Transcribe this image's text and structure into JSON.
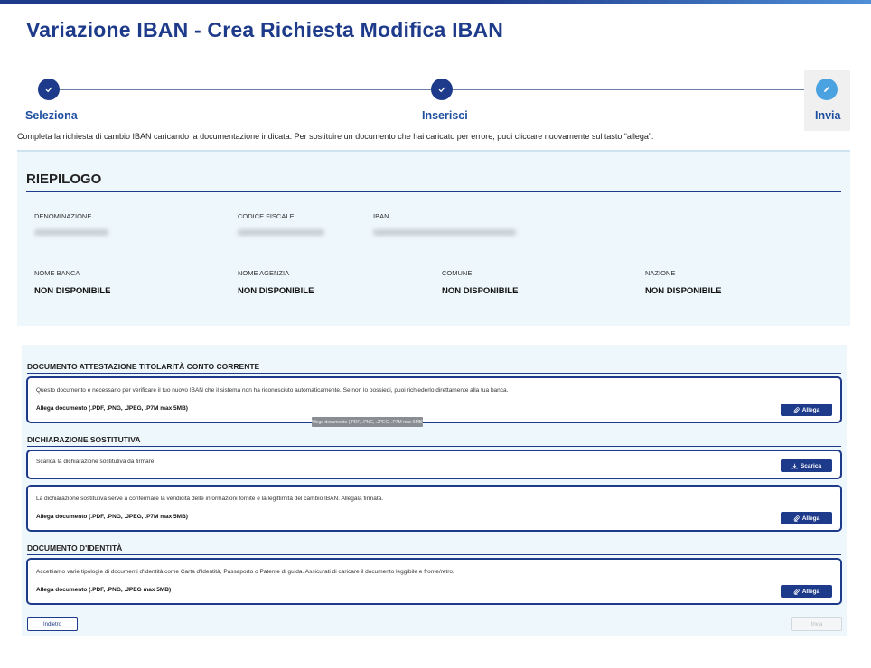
{
  "page": {
    "title": "Variazione IBAN - Crea Richiesta Modifica IBAN",
    "intro": "Completa la richiesta di cambio IBAN caricando la documentazione indicata. Per sostituire un documento che hai caricato per errore, puoi cliccare nuovamente sul tasto “allega”."
  },
  "stepper": {
    "steps": [
      {
        "label": "Seleziona",
        "state": "completed",
        "icon": "check-icon"
      },
      {
        "label": "Inserisci",
        "state": "completed",
        "icon": "check-icon"
      },
      {
        "label": "Invia",
        "state": "active",
        "icon": "pencil-icon"
      }
    ]
  },
  "summary": {
    "title": "RIEPILOGO",
    "fields": [
      {
        "label": "DENOMINAZIONE",
        "value": ""
      },
      {
        "label": "CODICE FISCALE",
        "value": ""
      },
      {
        "label": "IBAN",
        "value": ""
      },
      {
        "label": "NOME BANCA",
        "value": "NON DISPONIBILE"
      },
      {
        "label": "NOME AGENZIA",
        "value": "NON DISPONIBILE"
      },
      {
        "label": "COMUNE",
        "value": "NON DISPONIBILE"
      },
      {
        "label": "NAZIONE",
        "value": "NON DISPONIBILE"
      }
    ]
  },
  "documents": {
    "section1": {
      "title": "DOCUMENTO ATTESTAZIONE TITOLARITÀ CONTO CORRENTE",
      "desc": "Questo documento è necessario per verificare il tuo nuovo IBAN che il sistema non ha riconosciuto automaticamente. Se non lo possiedi, puoi richiederlo direttamente alla tua banca.",
      "allow": "Allega documento (.PDF, .PNG, .JPEG, .P7M max 5MB)",
      "button": "Allega"
    },
    "tooltip": "Allega documento (.PDF, .PNG, .JPEG, .P7M max 5MB)",
    "section2": {
      "title": "DICHIARAZIONE SOSTITUTIVA",
      "download_desc": "Scarica la dichiarazione sostitutiva da firmare",
      "download_button": "Scarica",
      "desc": "La dichiarazione sostitutiva serve a confermare la veridicità delle informazioni fornite e la legittimità del cambio IBAN. Allegala firmata.",
      "allow": "Allega documento (.PDF, .PNG, .JPEG, .P7M max 5MB)",
      "button": "Allega"
    },
    "section3": {
      "title": "DOCUMENTO D'IDENTITÀ",
      "desc": "Accettiamo varie tipologie di documenti d'identità come Carta d'Identità, Passaporto o Patente di guida. Assicurati di caricare il documento leggibile e fronte/retro.",
      "allow": "Allega documento (.PDF, .PNG, .JPEG max 5MB)",
      "button": "Allega"
    }
  },
  "footer": {
    "back": "Indietro",
    "send": "Invia"
  },
  "colors": {
    "primary": "#1e3a8a",
    "active_step": "#4aa3e0",
    "panel_bg": "#eef7fb"
  }
}
